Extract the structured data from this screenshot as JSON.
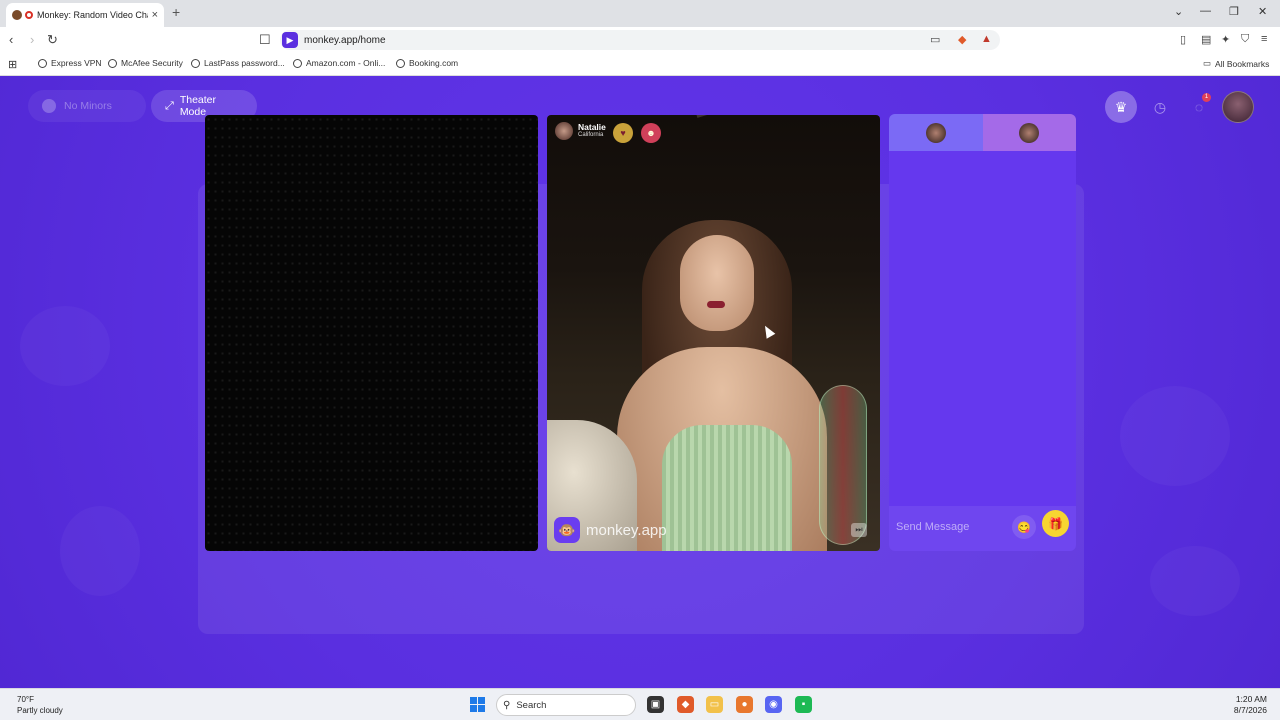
{
  "browser": {
    "tab_title": "Monkey: Random Video Chat",
    "new_tab": "+",
    "close_tab": "×",
    "url": "monkey.app/home",
    "bookmarks": [
      "Express VPN",
      "McAfee Security",
      "LastPass password...",
      "Amazon.com - Onli...",
      "Booking.com"
    ],
    "all_bookmarks": "All Bookmarks"
  },
  "page": {
    "no_minors_label": "No Minors",
    "theater_mode_label": "Theater Mode",
    "chat_badge": "1",
    "remote_user": {
      "name": "Natalie",
      "location": "California"
    },
    "brand_text": "monkey.app",
    "send_placeholder": "Send Message",
    "colors": {
      "background": "#5b2fe0",
      "panel": "#6538ee",
      "gift": "#f7d531"
    }
  },
  "taskbar": {
    "temp": "70°F",
    "weather": "Partly cloudy",
    "search_label": "Search",
    "time": "1:20 AM",
    "date": "8/7/2026"
  }
}
